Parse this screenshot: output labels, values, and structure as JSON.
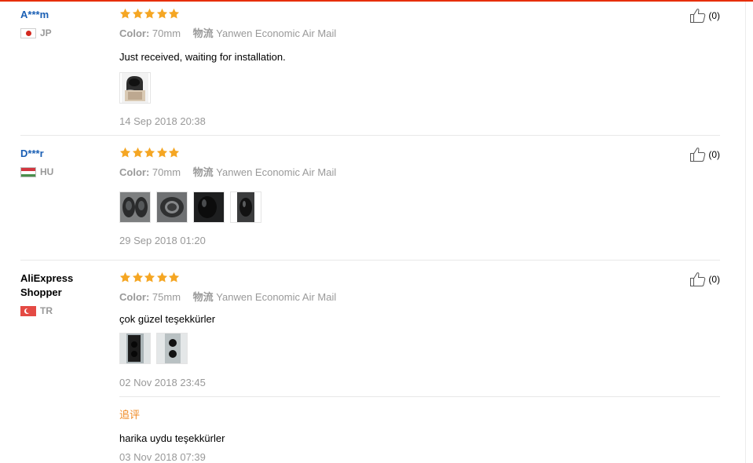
{
  "colors": {
    "accent": "#e62e04",
    "star": "#f5a623",
    "user_link": "#1a5fb4",
    "follow_label": "#f08a24"
  },
  "labels": {
    "color": "Color:",
    "shipping": "物流"
  },
  "reviews": [
    {
      "user": "A***m",
      "country": "JP",
      "flag": "jp",
      "stars": 5,
      "color_value": "70mm",
      "shipping_value": "Yanwen Economic Air Mail",
      "text": "Just received, waiting for installation.",
      "photos": [
        "photo-knob-hand"
      ],
      "date": "14 Sep 2018 20:38",
      "likes": "(0)"
    },
    {
      "user": "D***r",
      "country": "HU",
      "flag": "hu",
      "stars": 5,
      "color_value": "70mm",
      "shipping_value": "Yanwen Economic Air Mail",
      "text": "",
      "photos": [
        "photo-pair-front",
        "photo-pair-side",
        "photo-single-dark",
        "photo-mounted"
      ],
      "date": "29 Sep 2018 01:20",
      "likes": "(0)"
    },
    {
      "user": "AliExpress Shopper",
      "country": "TR",
      "flag": "tr",
      "stars": 5,
      "color_value": "75mm",
      "shipping_value": "Yanwen Economic Air Mail",
      "text": "çok güzel teşekkürler",
      "photos": [
        "photo-door-knobs",
        "photo-door-knobs-2"
      ],
      "date": "02 Nov 2018 23:45",
      "likes": "(0)",
      "followup": {
        "label": "追评",
        "text": "harika uydu teşekkürler",
        "date": "03 Nov 2018 07:39"
      }
    }
  ]
}
